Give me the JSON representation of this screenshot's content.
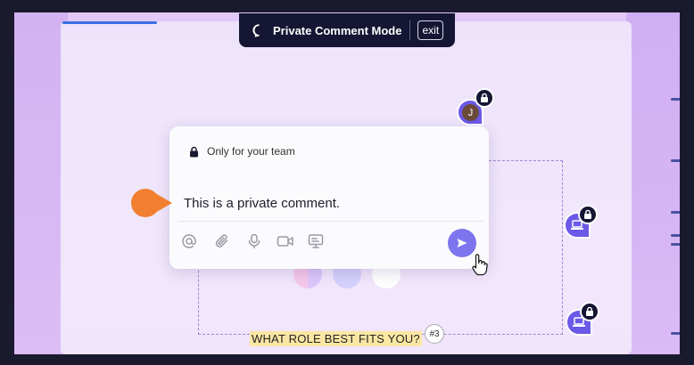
{
  "banner": {
    "title": "Private Comment Mode",
    "exit_label": "exit"
  },
  "comment_panel": {
    "visibility_label": "Only for your team",
    "text": "This is a private comment.",
    "toolbar": [
      "mention-icon",
      "attachment-icon",
      "microphone-icon",
      "video-icon",
      "screen-icon"
    ],
    "send_icon": "send-icon"
  },
  "avatars": [
    {
      "initial": "J",
      "locked": true
    },
    {
      "initial": "",
      "locked": true
    },
    {
      "initial": "",
      "locked": true
    }
  ],
  "question": {
    "text": "WHAT ROLE BEST FITS YOU?",
    "number": "#3"
  },
  "colors": {
    "accent": "#7d74ee",
    "banner": "#141633",
    "marker": "#f07f30",
    "highlight": "#fbe7a4"
  }
}
